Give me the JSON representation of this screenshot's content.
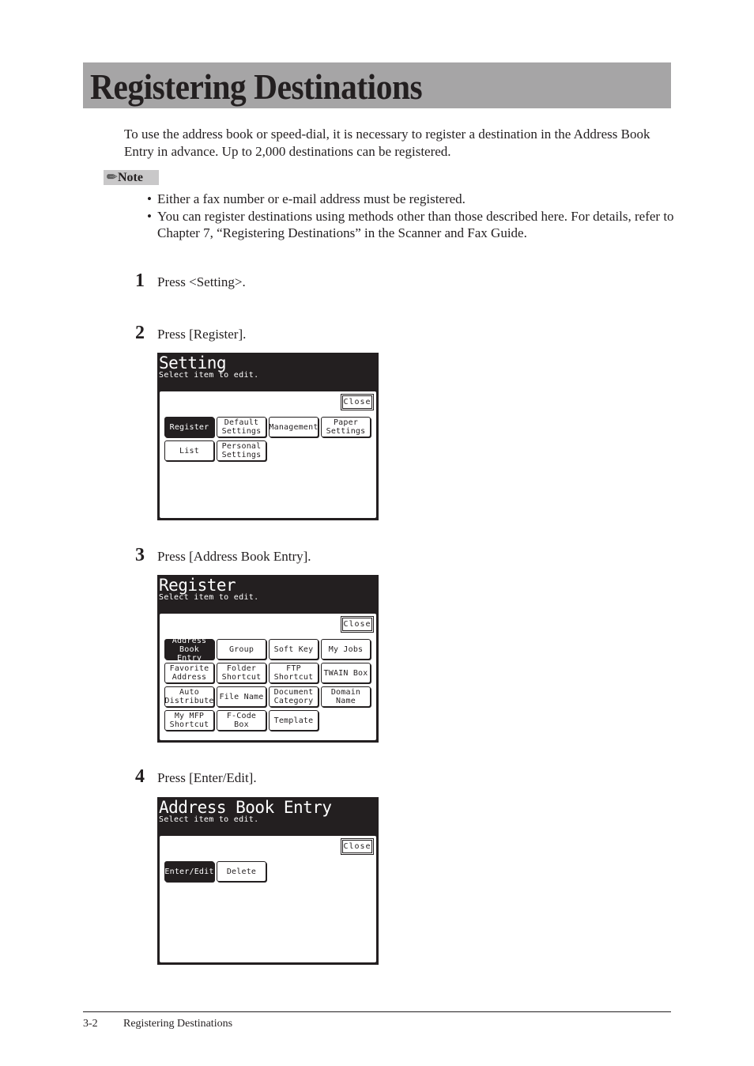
{
  "page": {
    "title": "Registering Destinations",
    "intro": "To use the address book or speed-dial, it is necessary to register a destination in the Address Book Entry in advance. Up to 2,000 destinations can be registered.",
    "note": {
      "icon": "pencil-icon",
      "label": "Note",
      "items": [
        "Either a fax number or e-mail address must be registered.",
        "You can register destinations using methods other than those described here. For details, refer to Chapter 7, “Registering Destinations” in the Scanner and Fax Guide."
      ]
    },
    "steps": [
      {
        "num": "1",
        "text": "Press <Setting>."
      },
      {
        "num": "2",
        "text": "Press [Register]."
      },
      {
        "num": "3",
        "text": "Press [Address Book Entry]."
      },
      {
        "num": "4",
        "text": "Press [Enter/Edit]."
      }
    ]
  },
  "screens": [
    {
      "title": "Setting",
      "subtitle": "Select item to edit.",
      "close": "Close",
      "buttons": [
        {
          "label": "Register",
          "selected": true
        },
        {
          "label": "Default\nSettings",
          "selected": false
        },
        {
          "label": "Management",
          "selected": false
        },
        {
          "label": "Paper\nSettings",
          "selected": false
        },
        {
          "label": "List",
          "selected": false
        },
        {
          "label": "Personal\nSettings",
          "selected": false
        }
      ]
    },
    {
      "title": "Register",
      "subtitle": "Select item to edit.",
      "close": "Close",
      "buttons": [
        {
          "label": "Address\nBook Entry",
          "selected": true
        },
        {
          "label": "Group",
          "selected": false
        },
        {
          "label": "Soft Key",
          "selected": false
        },
        {
          "label": "My Jobs",
          "selected": false
        },
        {
          "label": "Favorite\nAddress",
          "selected": false
        },
        {
          "label": "Folder\nShortcut",
          "selected": false
        },
        {
          "label": "FTP\nShortcut",
          "selected": false
        },
        {
          "label": "TWAIN Box",
          "selected": false
        },
        {
          "label": "Auto\nDistribute",
          "selected": false
        },
        {
          "label": "File Name",
          "selected": false
        },
        {
          "label": "Document\nCategory",
          "selected": false
        },
        {
          "label": "Domain\nName",
          "selected": false
        },
        {
          "label": "My MFP\nShortcut",
          "selected": false
        },
        {
          "label": "F-Code\nBox",
          "selected": false
        },
        {
          "label": "Template",
          "selected": false
        }
      ]
    },
    {
      "title": "Address Book Entry",
      "subtitle": "Select item to edit.",
      "close": "Close",
      "buttons": [
        {
          "label": "Enter/Edit",
          "selected": true
        },
        {
          "label": "Delete",
          "selected": false
        }
      ]
    }
  ],
  "footer": {
    "page_number": "3-2",
    "section": "Registering Destinations"
  }
}
